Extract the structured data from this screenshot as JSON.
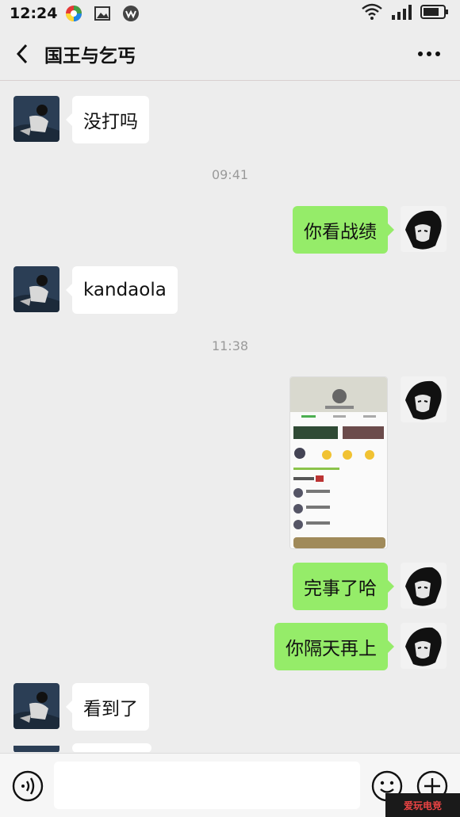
{
  "status_bar": {
    "time": "12:24"
  },
  "header": {
    "title": "国王与乞丐"
  },
  "messages": [
    {
      "side": "in",
      "text": "没打吗"
    },
    {
      "timestamp": "09:41"
    },
    {
      "side": "out",
      "text": "你看战绩"
    },
    {
      "side": "in",
      "text": "kandaola"
    },
    {
      "timestamp": "11:38"
    },
    {
      "side": "out",
      "type": "image"
    },
    {
      "side": "out",
      "text": "完事了哈"
    },
    {
      "side": "out",
      "text": "你隔天再上"
    },
    {
      "side": "in",
      "text": "看到了"
    }
  ],
  "input_bar": {
    "placeholder": ""
  },
  "watermark": {
    "text": "爱玩电竞"
  },
  "colors": {
    "bubble_out": "#95ec69",
    "bubble_in": "#ffffff",
    "background": "#ededed"
  }
}
